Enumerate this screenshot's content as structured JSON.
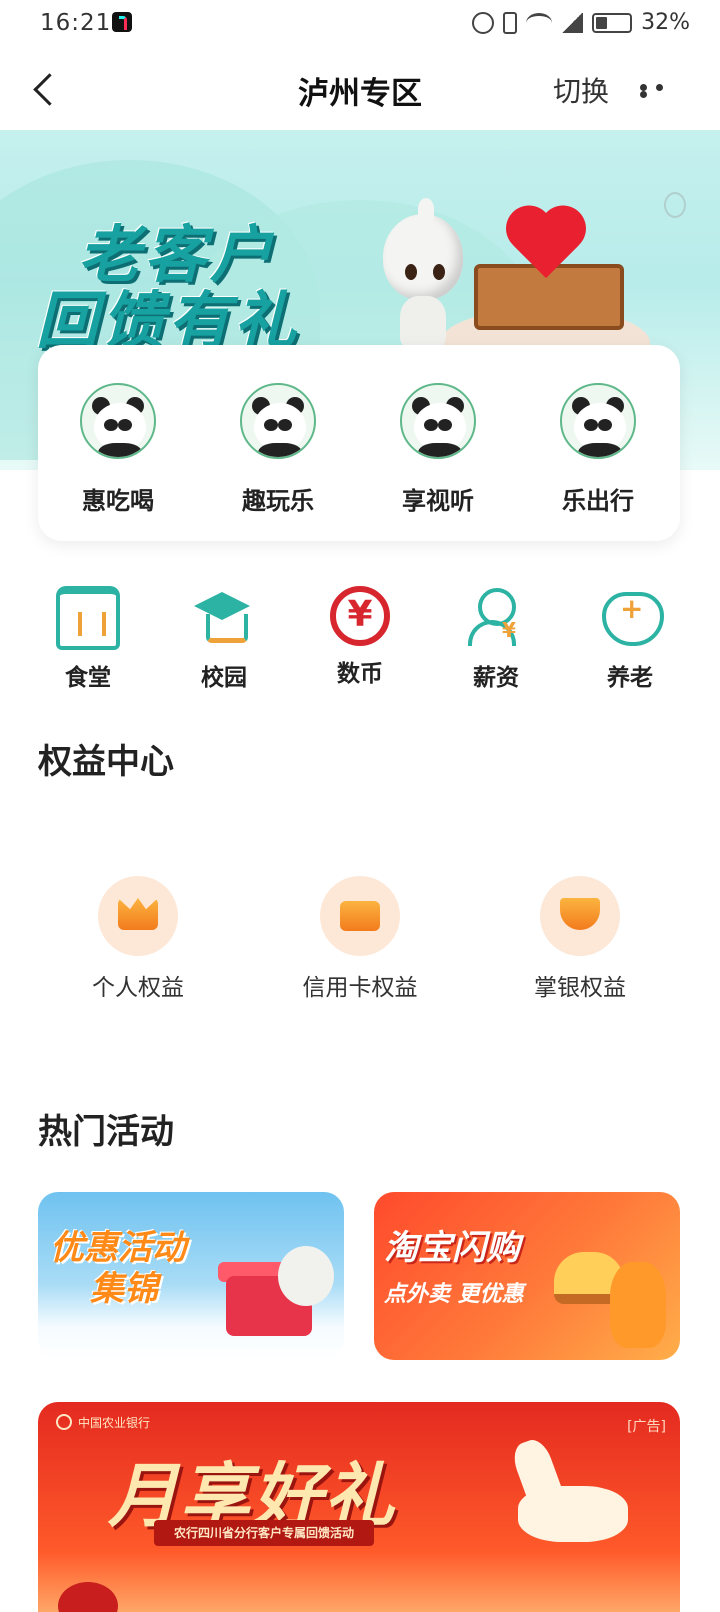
{
  "status_bar": {
    "time": "16:21",
    "battery": "32%"
  },
  "nav": {
    "title": "泸州专区",
    "switch_label": "切换"
  },
  "banner": {
    "line1": "老客户",
    "line2": "回馈有礼"
  },
  "categories": [
    {
      "label": "惠吃喝",
      "icon": "panda-bamboo-icon"
    },
    {
      "label": "趣玩乐",
      "icon": "panda-fan-icon"
    },
    {
      "label": "享视听",
      "icon": "panda-headphones-icon"
    },
    {
      "label": "乐出行",
      "icon": "panda-book-icon"
    }
  ],
  "services": [
    {
      "label": "食堂",
      "icon": "canteen-icon"
    },
    {
      "label": "校园",
      "icon": "graduation-cap-icon"
    },
    {
      "label": "数币",
      "icon": "digital-yuan-icon"
    },
    {
      "label": "薪资",
      "icon": "salary-icon"
    },
    {
      "label": "养老",
      "icon": "elderly-care-icon"
    }
  ],
  "rights": {
    "title": "权益中心",
    "items": [
      {
        "label": "个人权益",
        "icon": "crown-icon"
      },
      {
        "label": "信用卡权益",
        "icon": "credit-card-icon"
      },
      {
        "label": "掌银权益",
        "icon": "hand-money-icon"
      }
    ]
  },
  "activities": {
    "title": "热门活动",
    "left": {
      "line1": "优惠活动",
      "line2": "集锦"
    },
    "right": {
      "title": "淘宝闪购",
      "subtitle": "点外卖 更优惠"
    }
  },
  "ad": {
    "bank_name": "中国农业银行",
    "tag": "[广告]",
    "title": "月享好礼",
    "ribbon": "农行四川省分行客户专属回馈活动"
  },
  "colors": {
    "brand_teal": "#2cb3a3",
    "accent_orange": "#f0a23a",
    "coin_red": "#d7262e"
  }
}
